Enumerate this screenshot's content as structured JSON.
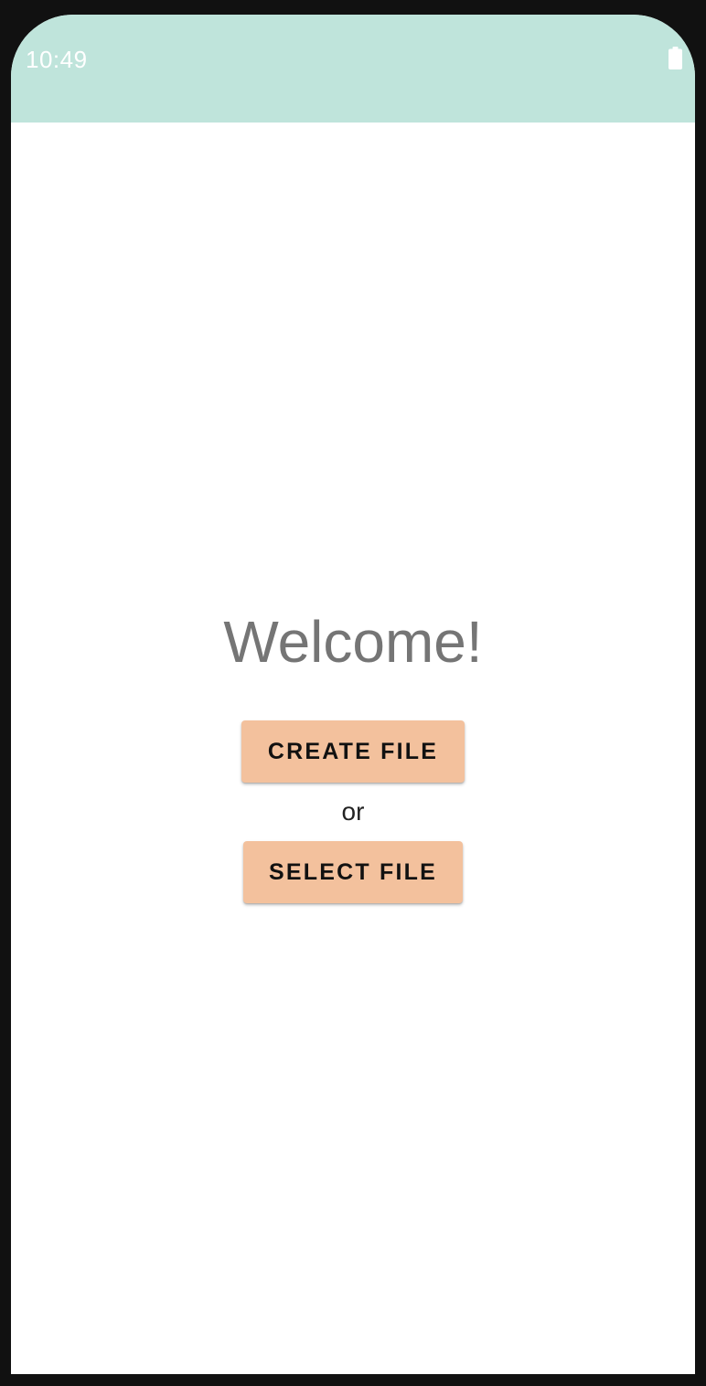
{
  "status_bar": {
    "time": "10:49",
    "battery_icon": "battery-full-icon",
    "background_color": "#bfe4db"
  },
  "main": {
    "title": "Welcome!",
    "create_button_label": "CREATE FILE",
    "separator_text": "or",
    "select_button_label": "SELECT FILE",
    "button_color": "#f3c19d"
  }
}
